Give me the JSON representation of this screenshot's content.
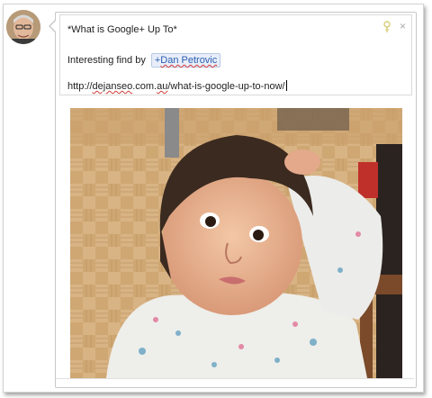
{
  "post": {
    "title": "*What is Google+ Up To*",
    "interesting_prefix": "Interesting find by",
    "mention_plus": "+",
    "mention_name": "Dan Petrovic",
    "url_prefix": "http://",
    "url_spelled": "dejanseo",
    "url_rest": ".com.",
    "url_au": "au",
    "url_path": "/what-is-google-up-to-now/"
  },
  "controls": {
    "pin_icon": "pin-icon",
    "close_icon": "close-icon",
    "close_glyph": "×"
  },
  "colors": {
    "mention_bg": "#e8eef9",
    "mention_text": "#2a5db0",
    "spell_underline": "#d43b3b",
    "pin": "#d9cf7a"
  }
}
